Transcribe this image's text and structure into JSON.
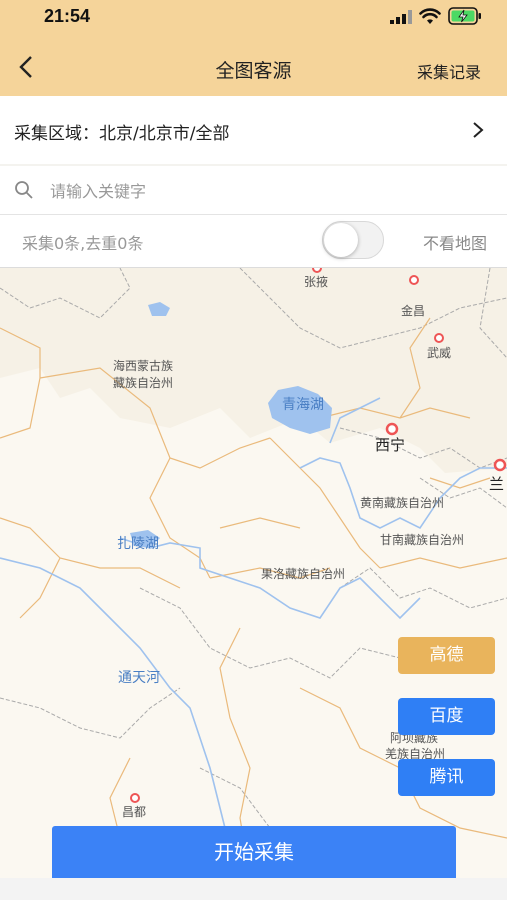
{
  "status_bar": {
    "time": "21:54"
  },
  "nav": {
    "title": "全图客源",
    "right_action": "采集记录"
  },
  "region": {
    "text": "采集区域：北京/北京市/全部"
  },
  "search": {
    "placeholder": "请输入关键字"
  },
  "stats": {
    "summary": "采集0条,去重0条",
    "toggle_label": "不看地图",
    "toggle_on": false
  },
  "map": {
    "labels": {
      "zhangye": "张掖",
      "jinchang": "金昌",
      "wuwei": "武威",
      "haixi_1": "海西蒙古族",
      "haixi_2": "藏族自治州",
      "qinghai_lake": "青海湖",
      "xining": "西宁",
      "lan": "兰",
      "huangnan": "黄南藏族自治州",
      "gannan": "甘南藏族自治州",
      "zhaling_lake": "扎陵湖",
      "guoluo": "果洛藏族自治州",
      "tongtian_river": "通天河",
      "aba_1": "阿坝藏族",
      "aba_2": "羌族自治州",
      "changdu": "昌都"
    }
  },
  "map_providers": {
    "gaode": "高德",
    "baidu": "百度",
    "tencent": "腾讯"
  },
  "actions": {
    "start": "开始采集"
  },
  "colors": {
    "header": "#f5d49a",
    "primary_blue": "#2f7ff5",
    "gaode_gold": "#e9b45c",
    "water": "#9fc2ee"
  }
}
